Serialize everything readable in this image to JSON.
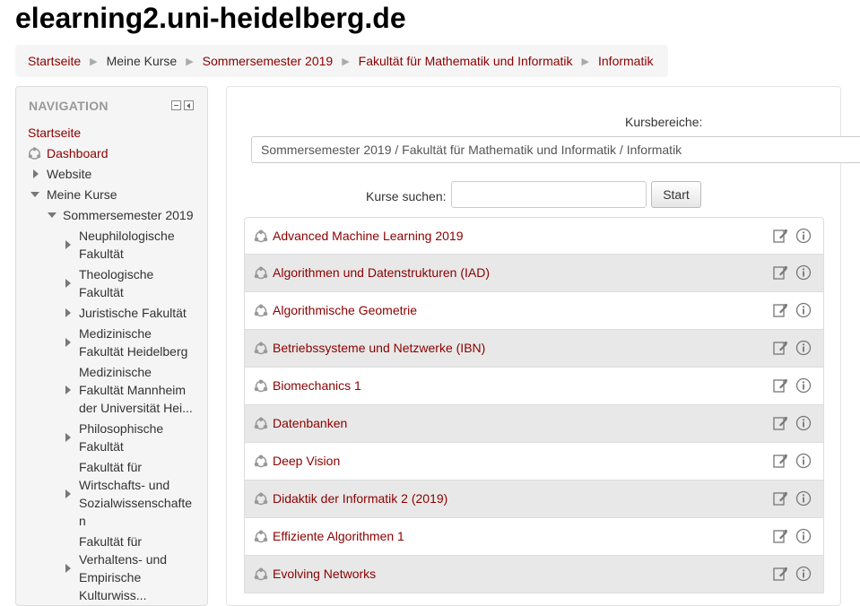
{
  "site": {
    "title": "elearning2.uni-heidelberg.de"
  },
  "breadcrumb": [
    {
      "label": "Startseite",
      "link": true
    },
    {
      "label": "Meine Kurse",
      "link": false
    },
    {
      "label": "Sommersemester 2019",
      "link": true
    },
    {
      "label": "Fakultät für Mathematik und Informatik",
      "link": true
    },
    {
      "label": "Informatik",
      "link": true
    }
  ],
  "breadcrumb_separator": "▶",
  "navigation": {
    "title": "NAVIGATION",
    "items": {
      "startseite": "Startseite",
      "dashboard": "Dashboard",
      "website": "Website",
      "meine_kurse": "Meine Kurse",
      "sommersemester": "Sommersemester 2019",
      "neuphil_1": "Neuphilologische",
      "neuphil_2": "Fakultät",
      "theo_1": "Theologische",
      "theo_2": "Fakultät",
      "jur": "Juristische Fakultät",
      "med_hd_1": "Medizinische",
      "med_hd_2": "Fakultät Heidelberg",
      "med_ma_1": "Medizinische",
      "med_ma_2": "Fakultät Mannheim",
      "med_ma_3": "der Universität Hei...",
      "phil_1": "Philosophische",
      "phil_2": "Fakultät",
      "wiso_1": "Fakultät für",
      "wiso_2": "Wirtschafts- und",
      "wiso_3": "Sozialwissenschafte",
      "wiso_4": "n",
      "verh_1": "Fakultät für",
      "verh_2": "Verhaltens- und",
      "verh_3": "Empirische",
      "verh_4": "Kulturwiss..."
    }
  },
  "main": {
    "kursbereiche_label": "Kursbereiche:",
    "kursbereiche_value": "Sommersemester 2019 / Fakultät für Mathematik und Informatik / Informatik",
    "search_label": "Kurse suchen:",
    "search_value": "",
    "search_button": "Start"
  },
  "courses": [
    "Advanced Machine Learning 2019",
    "Algorithmen und Datenstrukturen (IAD)",
    "Algorithmische Geometrie",
    "Betriebssysteme und Netzwerke (IBN)",
    "Biomechanics 1",
    "Datenbanken",
    "Deep Vision",
    "Didaktik der Informatik 2 (2019)",
    "Effiziente Algorithmen 1",
    "Evolving Networks"
  ],
  "colors": {
    "link": "#8b0000",
    "row_alt": "#e8e8e8",
    "nav_bg": "#f5f5f5"
  },
  "icons": {
    "course": "course-icon",
    "edit": "edit-icon",
    "info": "info-icon"
  }
}
